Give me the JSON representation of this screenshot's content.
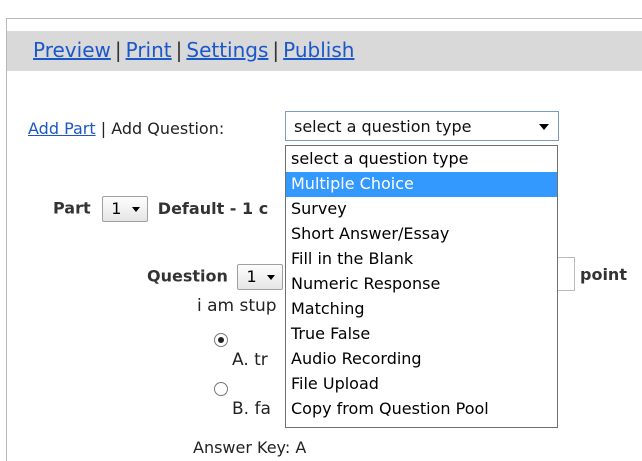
{
  "nav": {
    "preview": "Preview",
    "print": "Print",
    "settings": "Settings",
    "publish": "Publish",
    "separator": "|"
  },
  "toolbar": {
    "add_part": "Add Part",
    "separator": "|",
    "add_question": "Add Question:",
    "question_type_value": "select a question type"
  },
  "dropdown": {
    "options": [
      "select a question type",
      "Multiple Choice",
      "Survey",
      "Short Answer/Essay",
      "Fill in the Blank",
      "Numeric Response",
      "Matching",
      "True False",
      "Audio Recording",
      "File Upload",
      "Copy from Question Pool"
    ],
    "highlighted": "Multiple Choice"
  },
  "part": {
    "label": "Part",
    "number": "1",
    "title_visible": "Default - 1 c"
  },
  "question": {
    "label": "Question",
    "number": "1",
    "points_label": "point",
    "text_visible": "i am stup",
    "choices": [
      {
        "letter": "A.",
        "text_visible": "tr",
        "selected": true
      },
      {
        "letter": "B.",
        "text_visible": "fa",
        "selected": false
      }
    ],
    "answer_key": "Answer Key: A"
  }
}
